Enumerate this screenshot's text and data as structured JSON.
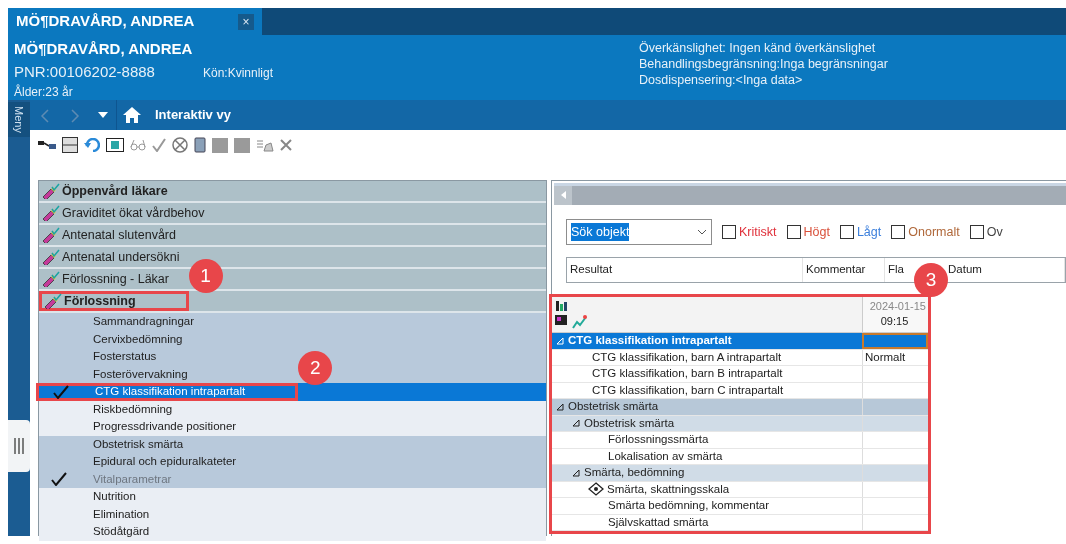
{
  "tab": {
    "title": "MÖ¶DRAVÅRD, ANDREA",
    "selected": true,
    "close_label": "×"
  },
  "patient": {
    "name": "MÖ¶DRAVÅRD, ANDREA",
    "pnr": "PNR:00106202-8888",
    "gender": "Kön:Kvinnligt",
    "age": "Ålder:23 år",
    "info": [
      "Överkänslighet: Ingen känd överkänslighet",
      "Behandlingsbegränsning:Inga begränsningar",
      "Dosdispensering:<Inga data>"
    ]
  },
  "side_menu": {
    "label": "Meny"
  },
  "nav": {
    "title": "Interaktiv vy",
    "back_disabled": true,
    "forward_disabled": true
  },
  "categories": [
    {
      "label": "Öppenvård läkare",
      "bold": true
    },
    {
      "label": "Graviditet ökat vårdbehov",
      "bold": false
    },
    {
      "label": "Antenatal slutenvård",
      "bold": false
    },
    {
      "label": "Antenatal undersökni",
      "bold": false
    },
    {
      "label": "Förlossning - Läkar",
      "bold": false
    },
    {
      "label": "Förlossning",
      "bold": true,
      "callout": "1"
    }
  ],
  "sub_items": [
    {
      "label": "Sammandragningar",
      "shaded": true,
      "selected": false,
      "checked": false,
      "disabled": false
    },
    {
      "label": "Cervixbedömning",
      "shaded": true,
      "selected": false,
      "checked": false,
      "disabled": false
    },
    {
      "label": "Fosterstatus",
      "shaded": true,
      "selected": false,
      "checked": false,
      "disabled": false
    },
    {
      "label": "Fosterövervakning",
      "shaded": true,
      "selected": false,
      "checked": false,
      "disabled": false
    },
    {
      "label": "CTG klassifikation intrapartalt",
      "shaded": true,
      "selected": true,
      "checked": true,
      "disabled": false,
      "callout": "2"
    },
    {
      "label": "Riskbedömning",
      "shaded": false,
      "selected": false,
      "checked": false,
      "disabled": false
    },
    {
      "label": "Progressdrivande positioner",
      "shaded": false,
      "selected": false,
      "checked": false,
      "disabled": false
    },
    {
      "label": "Obstetrisk smärta",
      "shaded": true,
      "selected": false,
      "checked": false,
      "disabled": false
    },
    {
      "label": "Epidural och epiduralkateter",
      "shaded": true,
      "selected": false,
      "checked": false,
      "disabled": false
    },
    {
      "label": "Vitalparametrar",
      "shaded": true,
      "selected": false,
      "checked": true,
      "disabled": true
    },
    {
      "label": "Nutrition",
      "shaded": false,
      "selected": false,
      "checked": false,
      "disabled": false
    },
    {
      "label": "Elimination",
      "shaded": false,
      "selected": false,
      "checked": false,
      "disabled": false
    },
    {
      "label": "Stödåtgärd",
      "shaded": false,
      "selected": false,
      "checked": false,
      "disabled": false
    }
  ],
  "search": {
    "value": "Sök objekt"
  },
  "filters": [
    {
      "label": "Kritiskt",
      "color": "#e0303a",
      "checked": false
    },
    {
      "label": "Högt",
      "color": "#d9503a",
      "checked": false
    },
    {
      "label": "Lågt",
      "color": "#3b7fdc",
      "checked": false
    },
    {
      "label": "Onormalt",
      "color": "#b0683a",
      "checked": false
    },
    {
      "label": "Ov",
      "color": "#444444",
      "checked": false
    }
  ],
  "result_columns": [
    "Resultat",
    "Kommentar",
    "Fla",
    "Datum"
  ],
  "grid": {
    "callout": "3",
    "date": "2024-01-15",
    "time": "09:15",
    "rows": [
      {
        "label": "CTG klassifikation intrapartalt",
        "kind": "group",
        "expanded": true,
        "selected": true,
        "children": [
          {
            "label": "CTG klassifikation, barn A intrapartalt",
            "kind": "item",
            "selected": false,
            "value": "Normalt"
          },
          {
            "label": "CTG klassifikation, barn B intrapartalt",
            "kind": "item",
            "selected": false
          },
          {
            "label": "CTG klassifikation, barn C intrapartalt",
            "kind": "item",
            "selected": false
          }
        ]
      },
      {
        "label": "Obstetrisk smärta",
        "kind": "group",
        "expanded": true,
        "selected": false,
        "children": [
          {
            "label": "Obstetrisk smärta",
            "kind": "group",
            "expanded": true,
            "selected": false,
            "children": [
              {
                "label": "Förlossningssmärta",
                "kind": "item",
                "selected": false
              },
              {
                "label": "Lokalisation av smärta",
                "kind": "item",
                "selected": false
              }
            ]
          },
          {
            "label": "Smärta, bedömning",
            "kind": "group",
            "expanded": true,
            "selected": false,
            "children": [
              {
                "label": "Smärta, skattningsskala",
                "kind": "scale",
                "selected": false
              },
              {
                "label": "Smärta bedömning, kommentar",
                "kind": "item",
                "selected": false
              },
              {
                "label": "Självskattad smärta",
                "kind": "item",
                "selected": false
              }
            ]
          }
        ]
      }
    ]
  }
}
